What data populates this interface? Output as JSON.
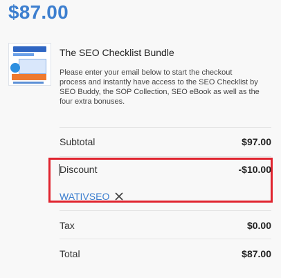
{
  "price": "$87.00",
  "product": {
    "title": "The SEO Checklist Bundle",
    "description": "Please enter your email below to start the checkout process and instantly have access to the SEO Checklist by SEO Buddy, the SOP Collection, SEO eBook as well as the four extra bonuses.",
    "thumbnail_icon": "product-bundle-thumbnail"
  },
  "summary": {
    "subtotal_label": "Subtotal",
    "subtotal_value": "$97.00",
    "discount_label": "Discount",
    "discount_value": "-$10.00",
    "coupon_code": "WATIVSEO",
    "remove_coupon_icon": "close-icon",
    "tax_label": "Tax",
    "tax_value": "$0.00",
    "total_label": "Total",
    "total_value": "$87.00"
  },
  "colors": {
    "accent_blue": "#3d7fcf",
    "highlight_red": "#e0232e",
    "background": "#f8f8f8"
  }
}
